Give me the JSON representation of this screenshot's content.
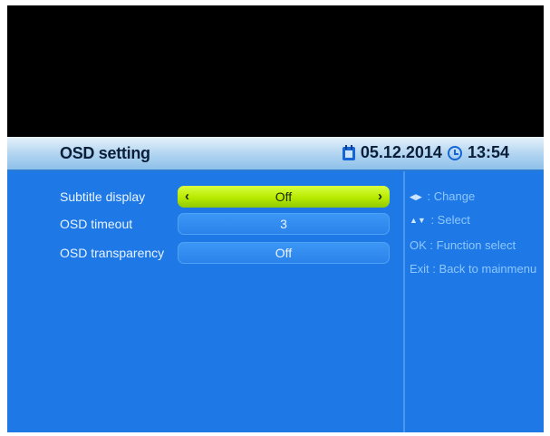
{
  "header": {
    "title": "OSD setting",
    "date": "05.12.2014",
    "time": "13:54"
  },
  "settings": [
    {
      "label": "Subtitle display",
      "value": "Off"
    },
    {
      "label": "OSD timeout",
      "value": "3"
    },
    {
      "label": "OSD transparency",
      "value": "Off"
    }
  ],
  "help": {
    "change": {
      "key": "◀▶",
      "text": ": Change"
    },
    "select": {
      "key": "▲▼",
      "text": ": Select"
    },
    "ok": {
      "key": "OK",
      "text": ": Function select"
    },
    "exit": {
      "key": "Exit",
      "text": ": Back to mainmenu"
    }
  },
  "colors": {
    "accent": "#b8ea00",
    "background": "#1e78e6",
    "help_text": "#8ec8ff"
  }
}
